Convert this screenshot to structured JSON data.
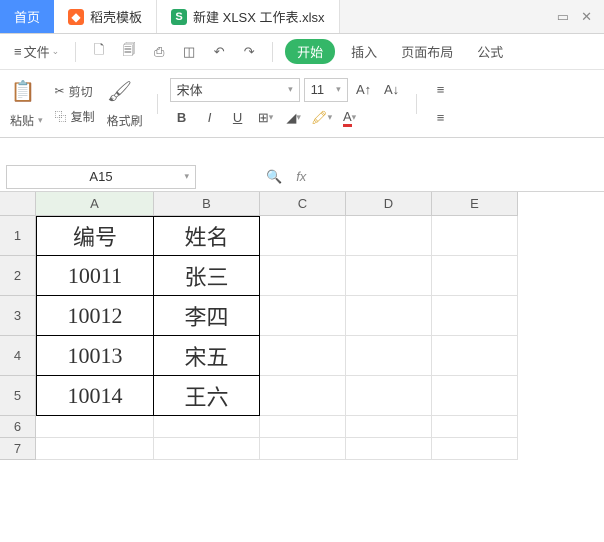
{
  "tabs": {
    "home": "首页",
    "template": "稻壳模板",
    "file": "新建 XLSX 工作表.xlsx"
  },
  "menu": {
    "file": "文件",
    "start": "开始",
    "insert": "插入",
    "layout": "页面布局",
    "formula": "公式"
  },
  "ribbon": {
    "paste": "粘贴",
    "cut": "剪切",
    "copy": "复制",
    "format": "格式刷",
    "font": "宋体",
    "size": "11"
  },
  "namebox": "A15",
  "cols": [
    "A",
    "B",
    "C",
    "D",
    "E"
  ],
  "rows": [
    "1",
    "2",
    "3",
    "4",
    "5",
    "6",
    "7"
  ],
  "data": {
    "A1": "编号",
    "B1": "姓名",
    "A2": "10011",
    "B2": "张三",
    "A3": "10012",
    "B3": "李四",
    "A4": "10013",
    "B4": "宋五",
    "A5": "10014",
    "B5": "王六"
  },
  "fx": "fx"
}
